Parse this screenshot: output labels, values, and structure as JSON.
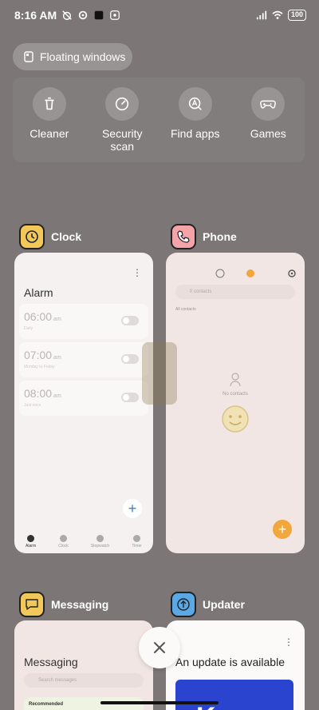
{
  "status_bar": {
    "time": "8:16 AM",
    "battery": "100"
  },
  "floating_windows": {
    "label": "Floating windows",
    "icon": "floating-window-icon"
  },
  "tools": [
    {
      "label": "Cleaner",
      "icon": "trash-icon"
    },
    {
      "label": "Security scan",
      "icon": "gauge-icon"
    },
    {
      "label": "Find apps",
      "icon": "search-app-icon"
    },
    {
      "label": "Games",
      "icon": "gamepad-icon"
    }
  ],
  "apps": {
    "clock": {
      "name": "Clock",
      "icon_color": "#f2c85a",
      "title": "Alarm",
      "alarms": [
        {
          "time": "06:00",
          "ampm": "am",
          "sub": "Daily"
        },
        {
          "time": "07:00",
          "ampm": "am",
          "sub": "Monday to Friday"
        },
        {
          "time": "08:00",
          "ampm": "am",
          "sub": "Just once"
        }
      ],
      "tabs": [
        "Alarm",
        "Clock",
        "Stopwatch",
        "Timer"
      ]
    },
    "phone": {
      "name": "Phone",
      "icon_color": "#f4a3a8",
      "search_placeholder": "0 contacts",
      "all_contacts": "All contacts",
      "empty": "No contacts"
    },
    "messaging": {
      "name": "Messaging",
      "icon_color": "#f2c85a",
      "title": "Messaging",
      "search_placeholder": "Search messages",
      "recommended": "Recommended"
    },
    "updater": {
      "name": "Updater",
      "icon_color": "#5aa9e6",
      "title": "An update is available",
      "banner_text": "K"
    }
  },
  "accent": {
    "clock_fab": "#3b82c4",
    "phone_fab": "#f2a73d"
  }
}
